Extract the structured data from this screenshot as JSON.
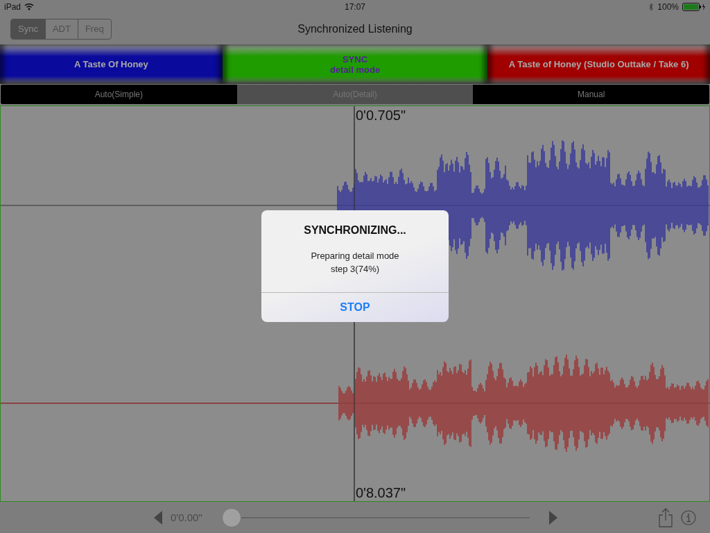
{
  "status_bar": {
    "device": "iPad",
    "time": "17:07",
    "battery": "100%"
  },
  "nav": {
    "title": "Synchronized Listening",
    "modes": [
      {
        "label": "Sync",
        "selected": true
      },
      {
        "label": "ADT",
        "selected": false
      },
      {
        "label": "Freq",
        "selected": false
      }
    ]
  },
  "tracks": [
    {
      "kind": "track",
      "color": "#0a0a9c",
      "title": "A Taste Of Honey"
    },
    {
      "kind": "sync",
      "color": "#1e9c00",
      "title": "SYNC",
      "subtitle": "detail mode"
    },
    {
      "kind": "track",
      "color": "#a00000",
      "title": "A Taste of Honey (Studio Outtake / Take 6)"
    }
  ],
  "sync_tabs": [
    {
      "label": "Auto(Simple)",
      "selected": false
    },
    {
      "label": "Auto(Detail)",
      "selected": true
    },
    {
      "label": "Manual",
      "selected": false
    }
  ],
  "waveform": {
    "top_time": "0'0.705\"",
    "bottom_time": "0'8.037\""
  },
  "dialog": {
    "title": "SYNCHRONIZING...",
    "message": "Preparing detail mode",
    "detail": "step 3(74%)",
    "button": "STOP"
  },
  "toolbar": {
    "time": "0'0.00\"",
    "position": {
      "level": 0
    }
  }
}
